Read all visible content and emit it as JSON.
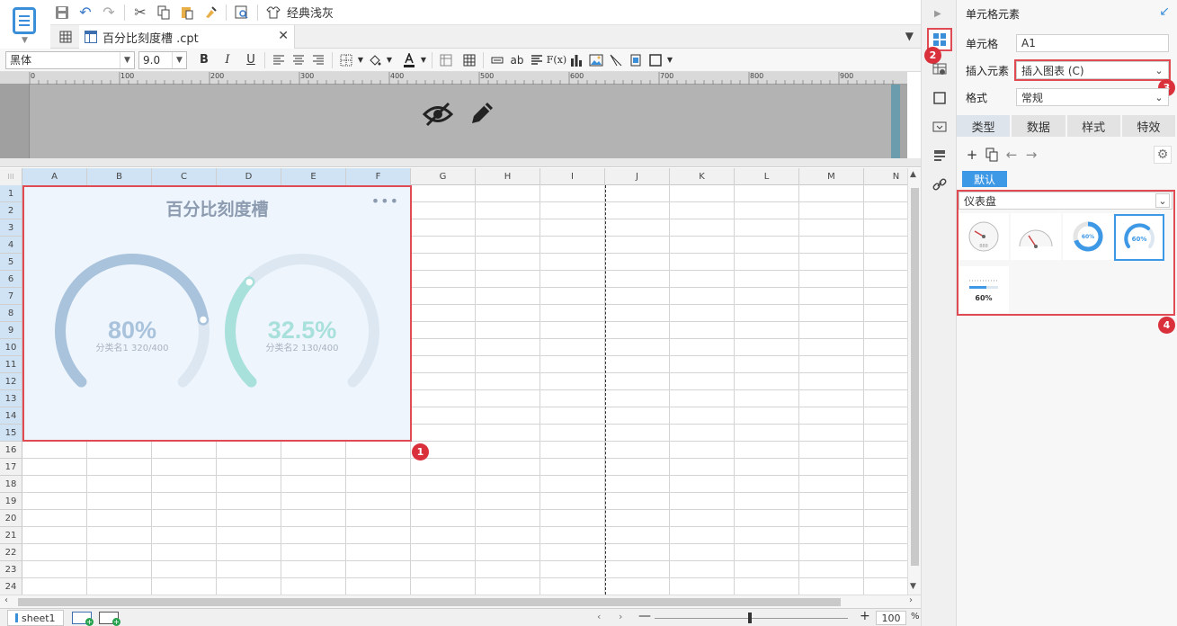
{
  "toolbar": {
    "theme_label": "经典浅灰"
  },
  "tab": {
    "file_name": "百分比刻度槽 .cpt"
  },
  "format_bar": {
    "font_family": "黑体",
    "font_size": "9.0",
    "bold": "B",
    "italic": "I",
    "underline": "U",
    "text_ab": "ab",
    "formula": "F(x)"
  },
  "ruler": {
    "ticks": [
      "0",
      "100",
      "200",
      "300",
      "400",
      "500",
      "600",
      "700",
      "800",
      "900"
    ]
  },
  "grid": {
    "columns": [
      "A",
      "B",
      "C",
      "D",
      "E",
      "F",
      "G",
      "H",
      "I",
      "J",
      "K",
      "L",
      "M",
      "N"
    ],
    "rows": [
      "1",
      "2",
      "3",
      "4",
      "5",
      "6",
      "7",
      "8",
      "9",
      "10",
      "11",
      "12",
      "13",
      "14",
      "15",
      "16",
      "17",
      "18",
      "19",
      "20",
      "21",
      "22",
      "23",
      "24"
    ]
  },
  "chart": {
    "title": "百分比刻度槽",
    "more": "•••",
    "gauges": [
      {
        "value_label": "80%",
        "sub_label": "分类名1 320/400",
        "percent": 80,
        "value": 320,
        "max": 400,
        "color": "#a9c3dc",
        "track": "#dde7f1"
      },
      {
        "value_label": "32.5%",
        "sub_label": "分类名2 130/400",
        "percent": 32.5,
        "value": 130,
        "max": 400,
        "color": "#a8e0db",
        "track": "#dde7f1"
      }
    ]
  },
  "badges": [
    "1",
    "2",
    "3",
    "4"
  ],
  "status": {
    "sheet_name": "sheet1",
    "zoom_value": "100",
    "zoom_unit": "%",
    "zoom_minus": "—",
    "zoom_plus": "+"
  },
  "panel": {
    "title": "单元格元素",
    "cell_label": "单元格",
    "cell_value": "A1",
    "insert_label": "插入元素",
    "insert_value": "插入图表 (C)",
    "format_label": "格式",
    "format_value": "常规",
    "tabs": [
      "类型",
      "数据",
      "样式",
      "特效"
    ],
    "default_chip": "默认",
    "gauge_type": "仪表盘",
    "thumb_labels": [
      "60%",
      "60%",
      "60%"
    ]
  },
  "colors": {
    "accent": "#3d98e5",
    "highlight": "#e04a52",
    "badge": "#d9303b"
  }
}
